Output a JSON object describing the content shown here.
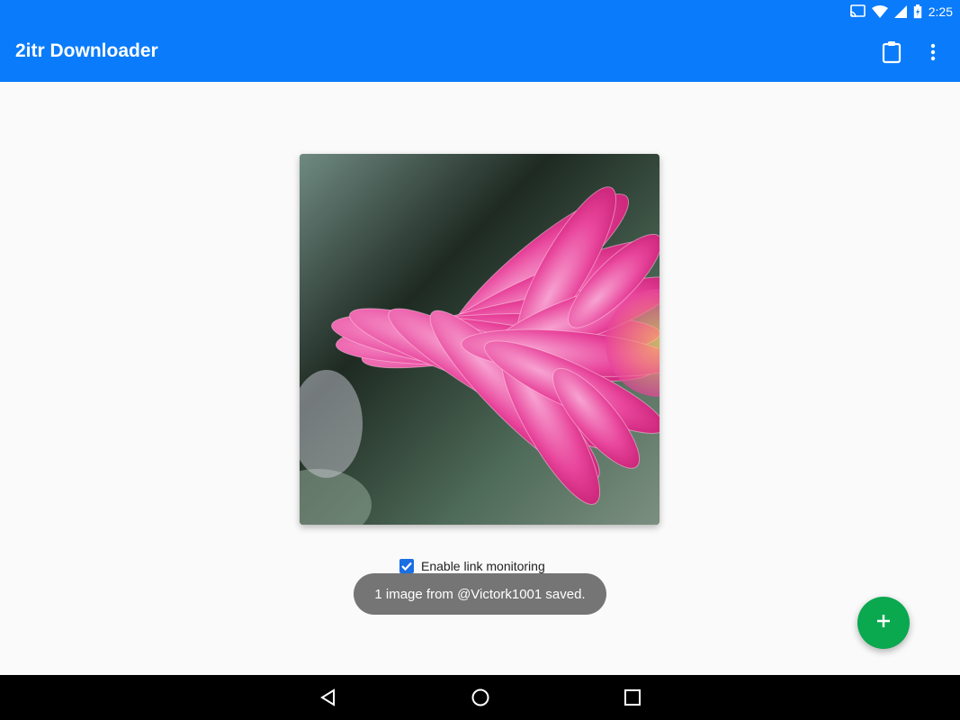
{
  "status_bar": {
    "time": "2:25",
    "icons": [
      "cast-icon",
      "wifi-icon",
      "signal-icon",
      "battery-charging-icon"
    ]
  },
  "app_bar": {
    "title": "2itr Downloader",
    "actions": [
      "clipboard-icon",
      "more-vert-icon"
    ]
  },
  "main": {
    "image_description": "pink dahlia flower photo",
    "checkboxes": [
      {
        "label": "Enable link monitoring",
        "checked": true
      },
      {
        "label": "",
        "checked": false
      }
    ]
  },
  "toast": {
    "message": "1 image from @Victork1001 saved."
  },
  "fab": {
    "icon": "add-icon"
  },
  "nav_bar": {
    "buttons": [
      "back-icon",
      "home-icon",
      "recents-icon"
    ]
  },
  "colors": {
    "primary": "#0a7bfb",
    "fab": "#0aa84f",
    "checkbox": "#1a6fe3",
    "toast": "#757575"
  }
}
